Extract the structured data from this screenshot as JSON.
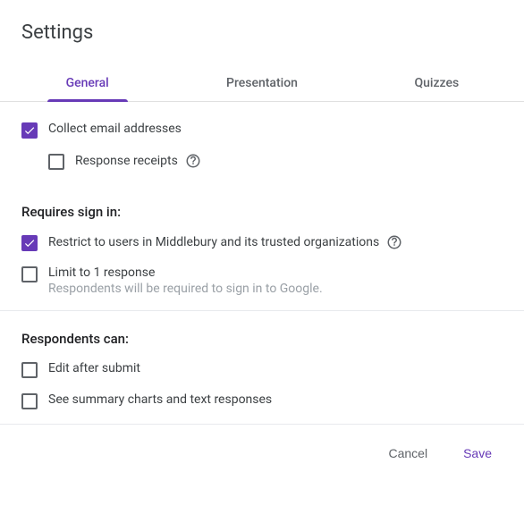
{
  "colors": {
    "accent": "#673ab7"
  },
  "title": "Settings",
  "tabs": [
    {
      "label": "General",
      "active": true
    },
    {
      "label": "Presentation",
      "active": false
    },
    {
      "label": "Quizzes",
      "active": false
    }
  ],
  "options": {
    "collect_email": {
      "label": "Collect email addresses",
      "checked": true
    },
    "response_receipts": {
      "label": "Response receipts",
      "checked": false
    }
  },
  "signin": {
    "heading": "Requires sign in:",
    "restrict": {
      "label": "Restrict to users in Middlebury and its trusted organizations",
      "checked": true
    },
    "limit": {
      "label": "Limit to 1 response",
      "sublabel": "Respondents will be required to sign in to Google.",
      "checked": false
    }
  },
  "respondents": {
    "heading": "Respondents can:",
    "edit": {
      "label": "Edit after submit",
      "checked": false
    },
    "summary": {
      "label": "See summary charts and text responses",
      "checked": false
    }
  },
  "actions": {
    "cancel": "Cancel",
    "save": "Save"
  }
}
